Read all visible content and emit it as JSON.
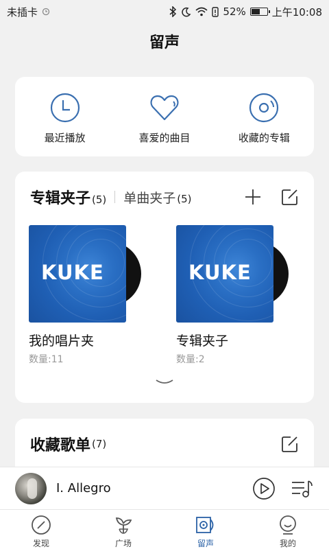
{
  "status": {
    "carrier": "未插卡",
    "battery_text": "52%",
    "battery_level": 0.52,
    "time": "上午10:08"
  },
  "page": {
    "title": "留声"
  },
  "quick_actions": [
    {
      "label": "最近播放",
      "icon": "clock-icon"
    },
    {
      "label": "喜爱的曲目",
      "icon": "heart-icon"
    },
    {
      "label": "收藏的专辑",
      "icon": "disc-icon"
    }
  ],
  "album_section": {
    "tab_main": "专辑夹子",
    "tab_main_count": "(5)",
    "tab_sub": "单曲夹子",
    "tab_sub_count": "(5)",
    "albums": [
      {
        "name": "我的唱片夹",
        "count": "数量:11",
        "logo": "KUKE"
      },
      {
        "name": "专辑夹子",
        "count": "数量:2",
        "logo": "KUKE"
      }
    ]
  },
  "playlist_section": {
    "title": "收藏歌单",
    "count": "(7)"
  },
  "player": {
    "track": "I. Allegro"
  },
  "nav": [
    {
      "label": "发现",
      "icon": "compass-icon",
      "active": false
    },
    {
      "label": "广场",
      "icon": "sprout-icon",
      "active": false
    },
    {
      "label": "留声",
      "icon": "vinyl-box-icon",
      "active": true
    },
    {
      "label": "我的",
      "icon": "user-icon",
      "active": false
    }
  ],
  "colors": {
    "accent": "#2a61a6",
    "icon_blue": "#3a6fb0",
    "cover_blue": "#2a6fc4"
  }
}
